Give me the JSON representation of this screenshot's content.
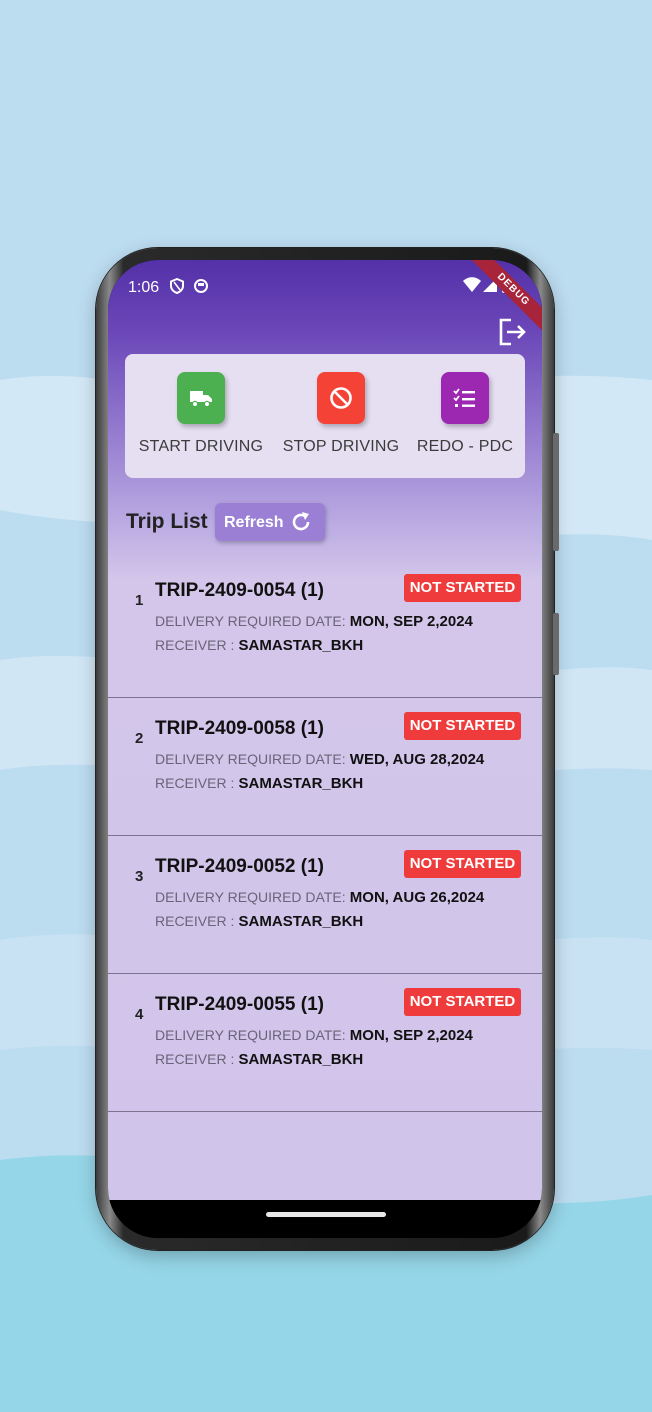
{
  "status_bar": {
    "time": "1:06",
    "debug_banner": "DEBUG"
  },
  "actions": [
    {
      "label": "START DRIVING",
      "color": "#4caf50",
      "icon": "truck-icon"
    },
    {
      "label": "STOP DRIVING",
      "color": "#f44336",
      "icon": "block-icon"
    },
    {
      "label": "REDO - PDC",
      "color": "#9c27b0",
      "icon": "checklist-icon"
    }
  ],
  "trip_list": {
    "title": "Trip List",
    "refresh_label": "Refresh",
    "delivery_label": "DELIVERY REQUIRED DATE:",
    "receiver_label": "RECEIVER :",
    "trips": [
      {
        "number": "1",
        "trip_id": "TRIP-2409-0054  (1)",
        "status": "NOT STARTED",
        "delivery_date": "MON, SEP 2,2024",
        "receiver": "SAMASTAR_BKH"
      },
      {
        "number": "2",
        "trip_id": "TRIP-2409-0058  (1)",
        "status": "NOT STARTED",
        "delivery_date": "WED, AUG 28,2024",
        "receiver": "SAMASTAR_BKH"
      },
      {
        "number": "3",
        "trip_id": "TRIP-2409-0052  (1)",
        "status": "NOT STARTED",
        "delivery_date": "MON, AUG 26,2024",
        "receiver": "SAMASTAR_BKH"
      },
      {
        "number": "4",
        "trip_id": "TRIP-2409-0055  (1)",
        "status": "NOT STARTED",
        "delivery_date": "MON, SEP 2,2024",
        "receiver": "SAMASTAR_BKH"
      }
    ]
  },
  "colors": {
    "status_badge": "#ef3b3b",
    "refresh_button": "#9b7fd4",
    "app_header": "#5431a8"
  }
}
